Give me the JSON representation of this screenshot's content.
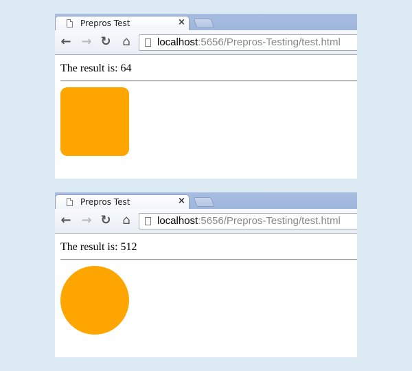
{
  "browsers": [
    {
      "tab_title": "Prepros Test",
      "close_glyph": "×",
      "url_host": "localhost",
      "url_rest": ":5656/Prepros-Testing/test.html",
      "result_text": "The result is: 64",
      "shape": "rounded-square",
      "shape_color": "#ffa500"
    },
    {
      "tab_title": "Prepros Test",
      "close_glyph": "×",
      "url_host": "localhost",
      "url_rest": ":5656/Prepros-Testing/test.html",
      "result_text": "The result is: 512",
      "shape": "circle",
      "shape_color": "#ffa500"
    }
  ],
  "toolbar_icons": {
    "back": "←",
    "forward": "→",
    "reload": "↻",
    "home": "⌂"
  }
}
